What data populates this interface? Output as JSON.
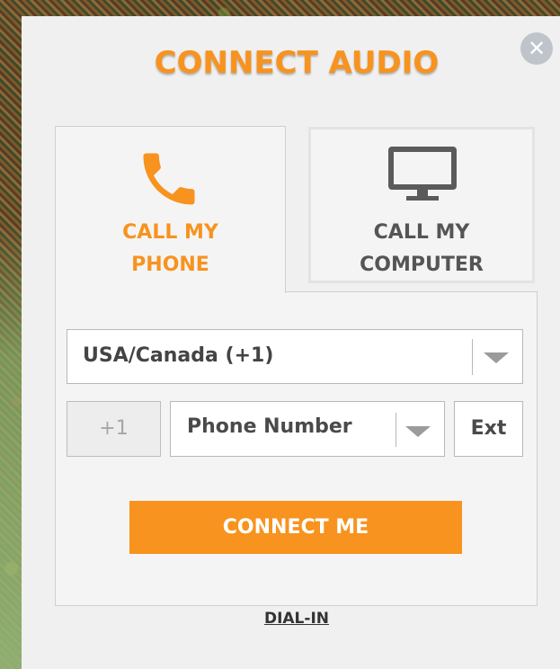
{
  "dialog": {
    "title": "CONNECT AUDIO",
    "close_icon": "close-icon",
    "close_glyph": "✕"
  },
  "tabs": [
    {
      "line1": "CALL MY",
      "line2": "PHONE",
      "icon": "phone-icon",
      "active": true
    },
    {
      "line1": "CALL MY",
      "line2": "COMPUTER",
      "icon": "monitor-icon",
      "active": false
    }
  ],
  "form": {
    "country": "USA/Canada (+1)",
    "prefix": "+1",
    "phone_placeholder": "Phone Number",
    "ext_label": "Ext",
    "connect_label": "CONNECT ME"
  },
  "footer": {
    "dial_in_label": "DIAL-IN"
  },
  "colors": {
    "accent": "#f7931e",
    "inactive_text": "#555555",
    "panel_bg": "#f4f4f4"
  }
}
